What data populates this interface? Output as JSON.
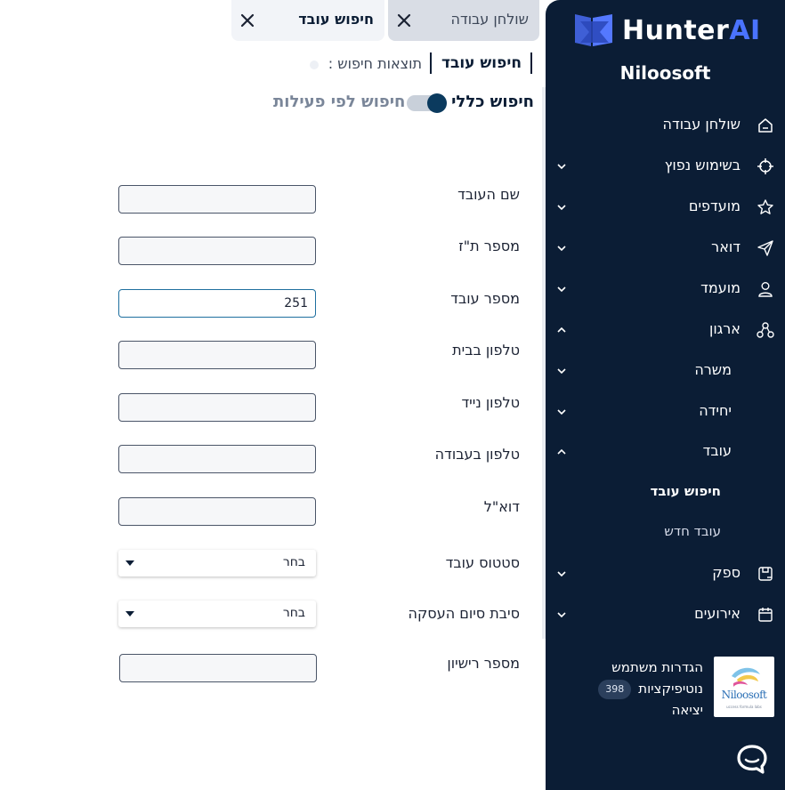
{
  "app": {
    "brand_main": "Hunter",
    "brand_accent": "AI",
    "company": "Niloosoft",
    "accent_color": "#4a73ff",
    "sidebar_bg": "#0b1d35"
  },
  "tabs": [
    {
      "label": "שולחן עבודה",
      "close_icon": "close-icon"
    },
    {
      "label": "חיפוש עובד",
      "close_icon": "close-icon"
    }
  ],
  "subtabs": {
    "search_label": "חיפוש עובד",
    "results_label": "תוצאות חיפוש :"
  },
  "toggle": {
    "general_label": "חיפוש כללי",
    "activity_label": "חיפוש לפי פעילות",
    "state": "on"
  },
  "form": {
    "employee_name": {
      "label": "שם העובד",
      "value": ""
    },
    "id_number": {
      "label": "מספר ת\"ז",
      "value": ""
    },
    "employee_number": {
      "label": "מספר עובד",
      "value": "251"
    },
    "home_phone": {
      "label": "טלפון בבית",
      "value": ""
    },
    "mobile_phone": {
      "label": "טלפון נייד",
      "value": ""
    },
    "work_phone": {
      "label": "טלפון בעבודה",
      "value": ""
    },
    "email": {
      "label": "דוא\"ל",
      "value": ""
    },
    "employee_status": {
      "label": "סטטוס עובד",
      "selected": "בחר"
    },
    "termination_reason": {
      "label": "סיבת סיום העסקה",
      "selected": "בחר"
    },
    "license_number": {
      "label": "מספר רישיון",
      "value": ""
    }
  },
  "sidebar": {
    "items": [
      {
        "label": "שולחן עבודה",
        "icon": "home-icon"
      },
      {
        "label": "בשימוש נפוץ",
        "icon": "crosshair-icon"
      },
      {
        "label": "מועדפים",
        "icon": "star-icon"
      },
      {
        "label": "דואר",
        "icon": "send-icon"
      },
      {
        "label": "מועמד",
        "icon": "user-icon"
      },
      {
        "label": "ארגון",
        "icon": "org-icon"
      },
      {
        "label": "משרה"
      },
      {
        "label": "יחידה"
      },
      {
        "label": "עובד"
      },
      {
        "label": "חיפוש עובד"
      },
      {
        "label": "עובד חדש"
      },
      {
        "label": "ספק",
        "icon": "supplier-icon"
      },
      {
        "label": "אירועים",
        "icon": "calendar-icon"
      }
    ],
    "user": {
      "settings_label": "הגדרות משתמש",
      "notifications_label": "נוטיפיקציות",
      "notifications_count": "398",
      "logout_label": "יציאה",
      "logo_text": "Niloosoft",
      "logo_tagline": "uccess formula labs"
    }
  }
}
